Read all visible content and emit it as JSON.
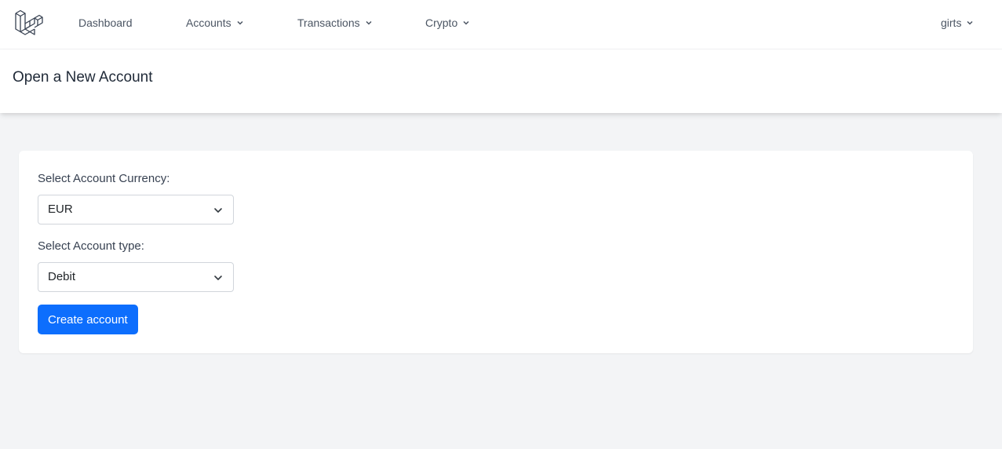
{
  "nav": {
    "logo_icon": "laravel-logo-icon",
    "items": [
      {
        "label": "Dashboard",
        "dropdown": false
      },
      {
        "label": "Accounts",
        "dropdown": true
      },
      {
        "label": "Transactions",
        "dropdown": true
      },
      {
        "label": "Crypto",
        "dropdown": true
      }
    ],
    "user": {
      "label": "girts",
      "dropdown": true
    }
  },
  "header": {
    "title": "Open a New Account"
  },
  "form": {
    "currency_label": "Select Account Currency:",
    "currency_value": "EUR",
    "type_label": "Select Account type:",
    "type_value": "Debit",
    "submit_label": "Create account"
  },
  "colors": {
    "primary": "#0d6efd",
    "page_background": "#f3f4f6",
    "card_background": "#ffffff"
  }
}
